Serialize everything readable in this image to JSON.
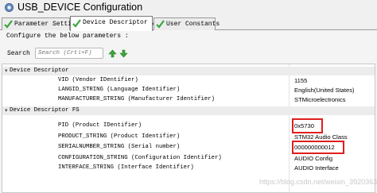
{
  "window": {
    "title": "USB_DEVICE Configuration"
  },
  "tabs": [
    {
      "label": "Parameter Settings",
      "active": false
    },
    {
      "label": "Device Descriptor",
      "active": true
    },
    {
      "label": "User Constants",
      "active": false
    }
  ],
  "panel": {
    "configure_label": "Configure the below parameters :",
    "search_label": "Search",
    "search_placeholder": "Search (Crtl+F)"
  },
  "tree": {
    "groups": [
      {
        "label": "Device Descriptor",
        "expanded": true
      },
      {
        "label": "Device Descriptor FS",
        "expanded": true
      }
    ],
    "rows": [
      {
        "name": "VID (Vendor IDentifier)",
        "value": "1155",
        "highlighted": false
      },
      {
        "name": "LANGID_STRING (Language Identifier)",
        "value": "English(United States)",
        "highlighted": false
      },
      {
        "name": "MANUFACTURER_STRING (Manufacturer Identifier)",
        "value": "STMicroelectronics",
        "highlighted": false
      },
      {
        "name": "PID (Product IDentifier)",
        "value": "0x5730",
        "highlighted": true
      },
      {
        "name": "PRODUCT_STRING (Product Identifier)",
        "value": "STM32 Audio Class",
        "highlighted": false
      },
      {
        "name": "SERIALNUMBER_STRING (Serial number)",
        "value": "000000000012",
        "highlighted": true
      },
      {
        "name": "CONFIGURATION_STRING (Configuration Identifier)",
        "value": "AUDIO Config",
        "highlighted": false
      },
      {
        "name": "INTERFACE_STRING (Interface Identifier)",
        "value": "AUDIO Interface",
        "highlighted": false
      }
    ]
  },
  "watermark": "https://blog.csdn.net/weixin_3920363",
  "colors": {
    "highlight": "#e01e1e",
    "check": "#3aa63a",
    "group_bg": "#ececec"
  },
  "icons": {
    "app": "gear-icon",
    "tab_check": "check-icon",
    "tab_close": "close-icon",
    "search_prev": "arrow-up-icon",
    "search_next": "arrow-down-icon",
    "expander": "collapse-icon"
  }
}
